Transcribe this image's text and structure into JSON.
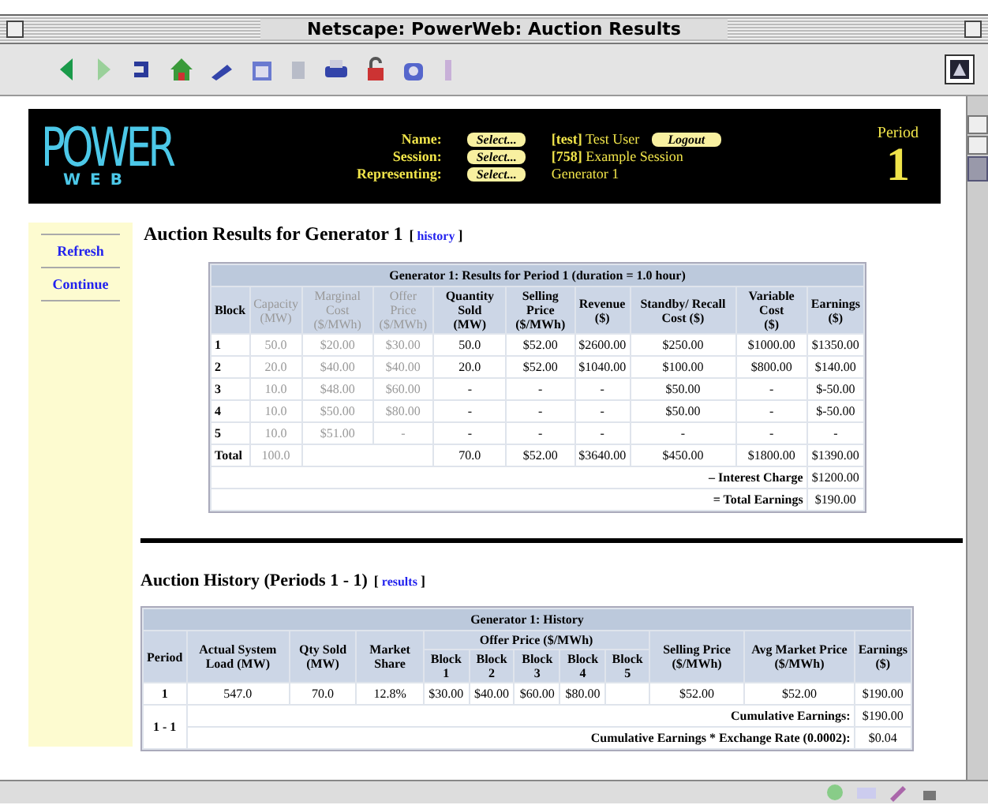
{
  "window": {
    "title": "Netscape: PowerWeb: Auction Results"
  },
  "header": {
    "logo": {
      "top": "POWER",
      "bottom": "WEB"
    },
    "fields": [
      {
        "label": "Name:",
        "button": "Select...",
        "value": "**[test]** Test User",
        "action": "Logout"
      },
      {
        "label": "Session:",
        "button": "Select...",
        "value": "**[758]** Example Session"
      },
      {
        "label": "Representing:",
        "button": "Select...",
        "value": "Generator 1"
      }
    ],
    "period": {
      "label": "Period",
      "value": "1"
    }
  },
  "sidebar": {
    "items": [
      "Refresh",
      "Continue"
    ]
  },
  "results": {
    "title": "Auction Results for Generator 1",
    "link": {
      "open": "[",
      "label": "history",
      "close": "]"
    },
    "table": {
      "caption": "Generator 1: Results for Period 1   (duration = 1.0 hour)",
      "columns": [
        {
          "label": "Block",
          "muted": false
        },
        {
          "label": "Capacity",
          "unit": "(MW)",
          "muted": true
        },
        {
          "label": "Marginal Cost",
          "unit": "($/MWh)",
          "muted": true
        },
        {
          "label": "Offer Price",
          "unit": "($/MWh)",
          "muted": true
        },
        {
          "label": "Quantity Sold",
          "unit": "(MW)",
          "muted": false
        },
        {
          "label": "Selling Price",
          "unit": "($/MWh)",
          "muted": false
        },
        {
          "label": "Revenue",
          "unit": "($)",
          "muted": false
        },
        {
          "label": "Standby/ Recall Cost ($)",
          "muted": false
        },
        {
          "label": "Variable Cost",
          "unit": "($)",
          "muted": false
        },
        {
          "label": "Earnings",
          "unit": "($)",
          "muted": false
        }
      ],
      "rows": [
        [
          "1",
          "50.0",
          "$20.00",
          "$30.00",
          "50.0",
          "$52.00",
          "$2600.00",
          "$250.00",
          "$1000.00",
          "$1350.00"
        ],
        [
          "2",
          "20.0",
          "$40.00",
          "$40.00",
          "20.0",
          "$52.00",
          "$1040.00",
          "$100.00",
          "$800.00",
          "$140.00"
        ],
        [
          "3",
          "10.0",
          "$48.00",
          "$60.00",
          "-",
          "-",
          "-",
          "$50.00",
          "-",
          "$-50.00"
        ],
        [
          "4",
          "10.0",
          "$50.00",
          "$80.00",
          "-",
          "-",
          "-",
          "$50.00",
          "-",
          "$-50.00"
        ],
        [
          "5",
          "10.0",
          "$51.00",
          "-",
          "-",
          "-",
          "-",
          "-",
          "-",
          "-"
        ]
      ],
      "total": {
        "label": "Total",
        "capacity": "100.0",
        "cells": [
          "70.0",
          "$52.00",
          "$3640.00",
          "$450.00",
          "$1800.00",
          "$1390.00"
        ]
      },
      "summary": [
        {
          "label": "– Interest Charge",
          "value": "$1200.00"
        },
        {
          "label": "= Total Earnings",
          "value": "$190.00"
        }
      ]
    }
  },
  "history": {
    "title": "Auction History (Periods 1 - 1)",
    "link": {
      "open": "[",
      "label": "results",
      "close": "]"
    },
    "table": {
      "caption": "Generator 1: History",
      "before": [
        {
          "label": "Period"
        },
        {
          "label": "Actual System Load (MW)"
        },
        {
          "label": "Qty Sold (MW)"
        },
        {
          "label": "Market Share"
        }
      ],
      "group": {
        "label": "Offer Price ($/MWh)",
        "blocks": [
          "Block 1",
          "Block 2",
          "Block 3",
          "Block 4",
          "Block 5"
        ]
      },
      "after": [
        {
          "label": "Selling Price ($/MWh)"
        },
        {
          "label": "Avg Market Price ($/MWh)"
        },
        {
          "label": "Earnings",
          "unit": "($)"
        }
      ],
      "rows": [
        [
          "1",
          "547.0",
          "70.0",
          "12.8%",
          "$30.00",
          "$40.00",
          "$60.00",
          "$80.00",
          null,
          "$52.00",
          "$52.00",
          "$190.00"
        ]
      ],
      "range": "1 - 1",
      "summary": [
        {
          "label": "Cumulative Earnings:",
          "value": "$190.00"
        },
        {
          "label": "Cumulative Earnings * Exchange Rate (0.0002):",
          "value": "$0.04"
        }
      ]
    }
  }
}
